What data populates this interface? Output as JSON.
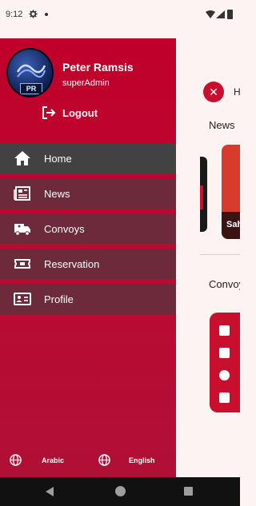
{
  "status_bar": {
    "time": "9:12",
    "icons": [
      "gear-icon",
      "dot-icon",
      "wifi-icon",
      "signal-icon",
      "battery-icon"
    ]
  },
  "profile": {
    "name": "Peter Ramsis",
    "role": "superAdmin",
    "avatar_text": "PR"
  },
  "logout_label": "Logout",
  "menu": [
    {
      "label": "Home",
      "icon": "home-icon",
      "active": true
    },
    {
      "label": "News",
      "icon": "newspaper-icon",
      "active": false
    },
    {
      "label": "Convoys",
      "icon": "ambulance-icon",
      "active": false
    },
    {
      "label": "Reservation",
      "icon": "ticket-icon",
      "active": false
    },
    {
      "label": "Profile",
      "icon": "id-card-icon",
      "active": false
    }
  ],
  "languages": [
    {
      "label": "Arabic",
      "icon": "globe-icon"
    },
    {
      "label": "English",
      "icon": "globe-icon"
    }
  ],
  "background_page": {
    "header_partial": "H",
    "news_title": "News",
    "news_card_caption_partial": "Sah",
    "convoy_title": "Convoy"
  },
  "colors": {
    "primary": "#c4002b",
    "menu_item": "#6c2a3b",
    "menu_active": "#424242",
    "page_bg": "#fdf3f2"
  }
}
